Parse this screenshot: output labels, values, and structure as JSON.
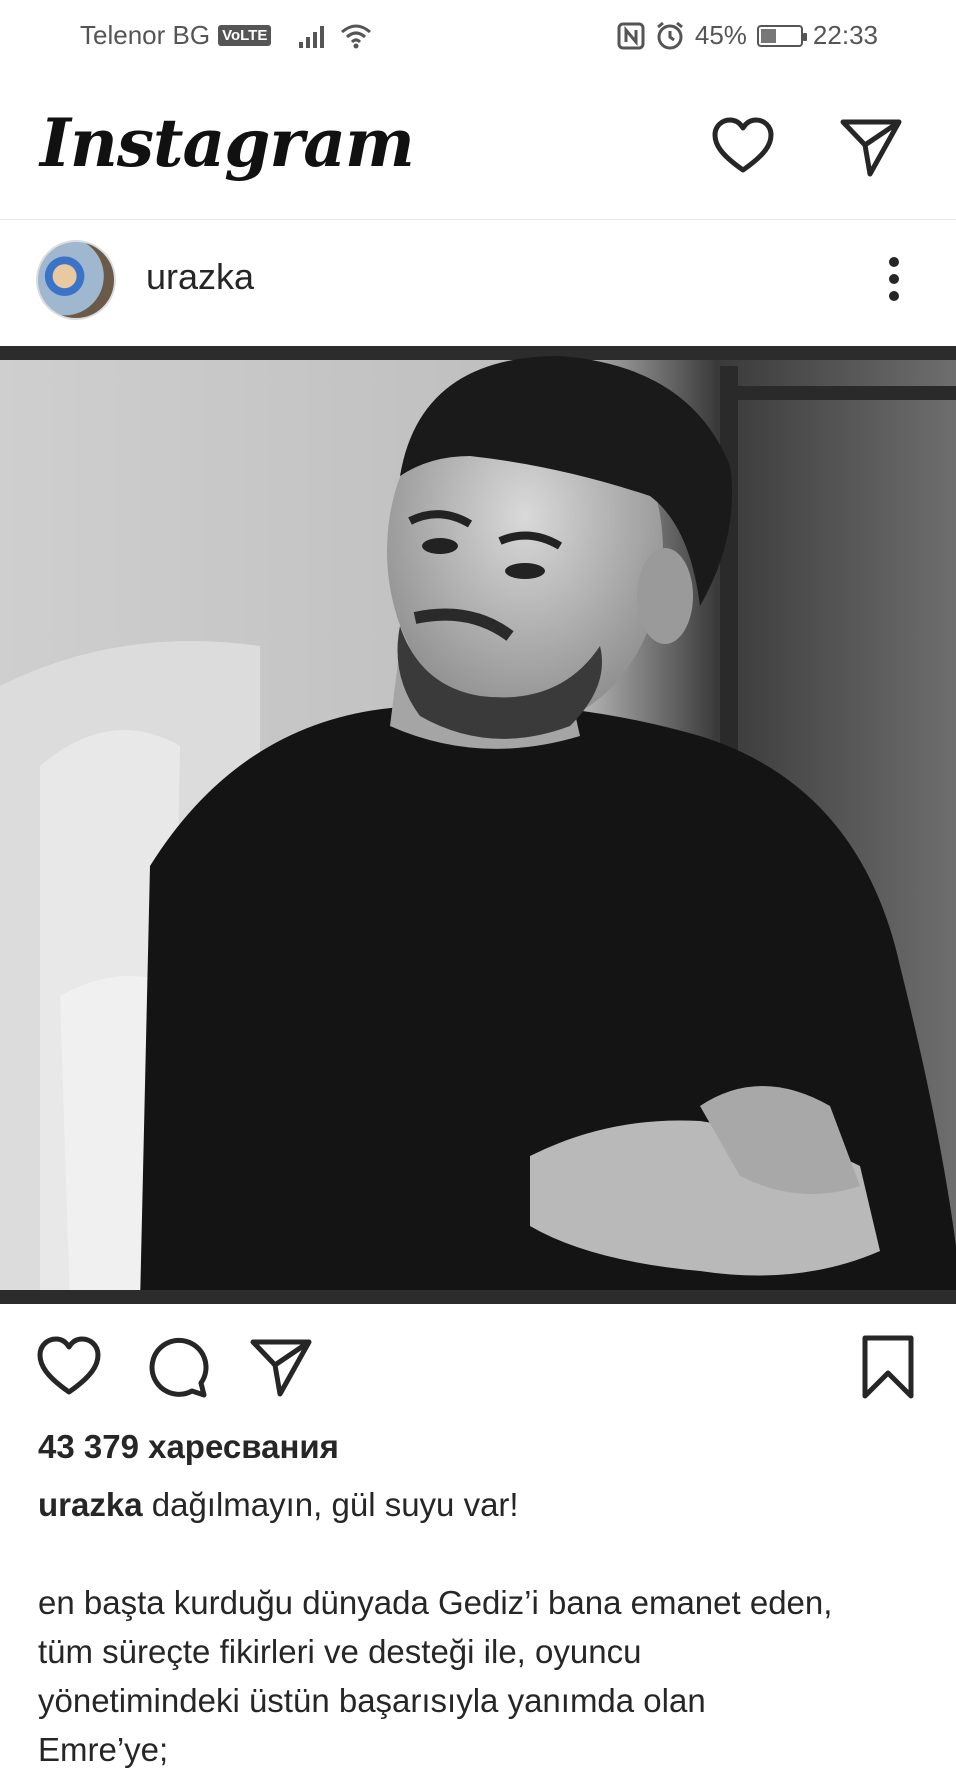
{
  "status_bar": {
    "carrier": "Telenor BG",
    "volte": "VoLTE",
    "battery_percent": "45%",
    "battery_level": 0.45,
    "time": "22:33"
  },
  "app": {
    "logo": "Instagram"
  },
  "post": {
    "username": "urazka",
    "likes": "43 379 харесвания",
    "caption_username": "urazka",
    "caption_first_line": "dağılmayın, gül suyu var!",
    "caption_paragraph_lines": [
      "en başta kurduğu dünyada Gediz’i bana emanet eden,",
      "tüm süreçte fikirleri ve desteği ile, oyuncu",
      "yönetimindeki üstün başarısıyla yanımda olan",
      "Emre’ye;"
    ]
  },
  "icons": {
    "header": [
      "heart-icon",
      "direct-message-icon"
    ],
    "post_actions": [
      "like-icon",
      "comment-icon",
      "share-icon",
      "bookmark-icon"
    ],
    "post_header": [
      "more-options-icon"
    ]
  },
  "colors": {
    "text": "#262626",
    "background": "#ffffff",
    "divider": "#e6e6e6"
  }
}
